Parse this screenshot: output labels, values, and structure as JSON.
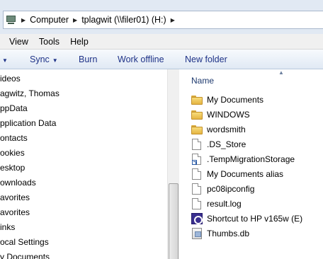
{
  "address": {
    "crumbs": [
      "Computer",
      "tplagwit (\\\\filer01) (H:)"
    ]
  },
  "menu": [
    "View",
    "Tools",
    "Help"
  ],
  "toolbar": {
    "sync_label": "Sync",
    "burn_label": "Burn",
    "work_offline_label": "Work offline",
    "new_folder_label": "New folder"
  },
  "nav": {
    "items": [
      "ideos",
      "agwitz, Thomas",
      "ppData",
      "pplication Data",
      "ontacts",
      "ookies",
      "esktop",
      "ownloads",
      "avorites",
      "avorites",
      "inks",
      "ocal Settings",
      "y Documents"
    ]
  },
  "content": {
    "column_name": "Name",
    "files": [
      {
        "name": "My Documents",
        "icon": "folder-icon"
      },
      {
        "name": "WINDOWS",
        "icon": "folder-icon"
      },
      {
        "name": "wordsmith",
        "icon": "folder-icon"
      },
      {
        "name": ".DS_Store",
        "icon": "file-icon"
      },
      {
        "name": ".TempMigrationStorage",
        "icon": "shortcut-file-icon"
      },
      {
        "name": "My Documents alias",
        "icon": "file-icon"
      },
      {
        "name": "pc08ipconfig",
        "icon": "file-icon"
      },
      {
        "name": "result.log",
        "icon": "file-icon"
      },
      {
        "name": "Shortcut to HP v165w (E)",
        "icon": "hp-drive-icon"
      },
      {
        "name": "Thumbs.db",
        "icon": "thumbs-db-icon"
      }
    ]
  }
}
